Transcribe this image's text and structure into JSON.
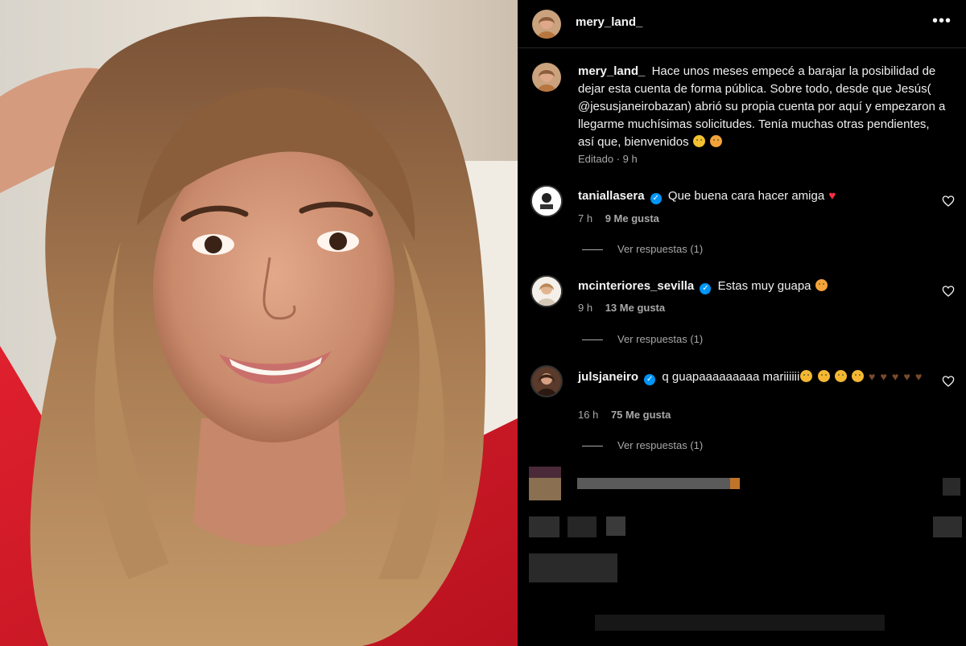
{
  "header": {
    "username": "mery_land_",
    "more_icon": "more-horizontal-icon"
  },
  "caption": {
    "username": "mery_land_",
    "text": "Hace unos meses empecé a barajar la posibilidad de dejar esta cuenta de forma pública. Sobre todo, desde que Jesús( @jesusjaneirobazan) abrió su propia cuenta por aquí y empezaron a llegarme muchísimas solicitudes. Tenía muchas otras pendientes, así que, bienvenidos",
    "meta": "Editado · 9 h"
  },
  "comments": [
    {
      "username": "taniallasera",
      "text": "Que buena cara hacer amiga",
      "time": "7 h",
      "likes": "9 Me gusta",
      "replies": "Ver respuestas (1)"
    },
    {
      "username": "mcinteriores_sevilla",
      "text": "Estas muy guapa",
      "time": "9 h",
      "likes": "13 Me gusta",
      "replies": "Ver respuestas (1)"
    },
    {
      "username": "julsjaneiro",
      "text": "q guapaaaaaaaaa mariiiiii",
      "time": "16 h",
      "likes": "75 Me gusta",
      "replies": "Ver respuestas (1)"
    }
  ],
  "colors": {
    "background": "#000000",
    "text": "#f5f5f5",
    "muted": "#a8a8a8",
    "verified": "#0095f6",
    "heart": "#ff3040"
  }
}
